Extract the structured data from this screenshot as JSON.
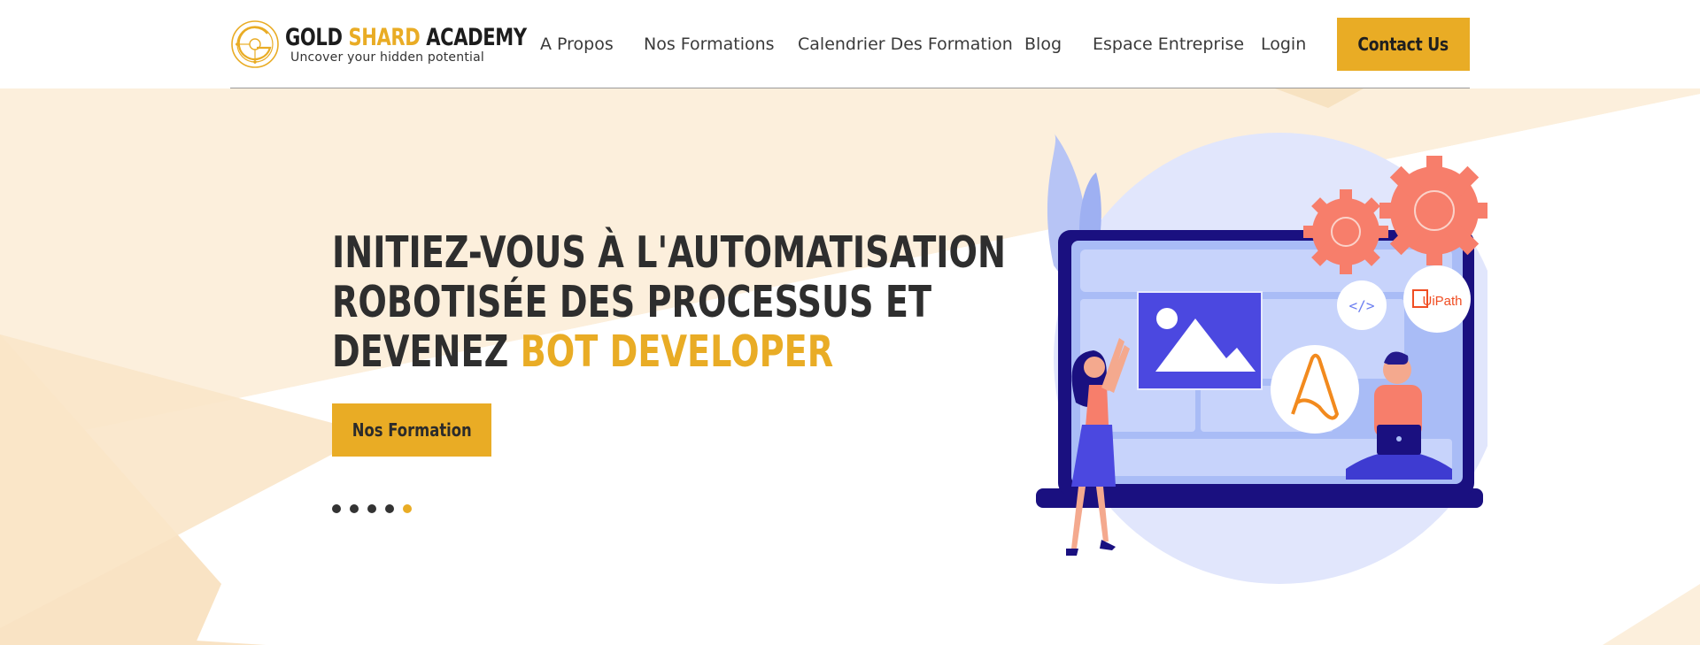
{
  "brand": {
    "name_part1": "GOLD",
    "name_part2": "SHARD",
    "name_part3": "ACADEMY",
    "tagline": "Uncover  your hidden potential",
    "accent_color": "#e9ac25"
  },
  "nav": {
    "items": [
      {
        "label": "A Propos"
      },
      {
        "label": "Nos Formations"
      },
      {
        "label": "Calendrier Des Formation"
      },
      {
        "label": "Blog"
      },
      {
        "label": "Espace Entreprise"
      },
      {
        "label": "Login"
      }
    ],
    "contact_label": "Contact Us"
  },
  "hero": {
    "headline_line1": "INITIEZ-VOUS À L'AUTOMATISATION",
    "headline_line2": "ROBOTISÉE DES PROCESSUS ET",
    "headline_line3_prefix": "DEVENEZ",
    "headline_line3_highlight": "BOT DEVELOPER",
    "cta_label": "Nos Formation",
    "slides_total": 5,
    "slide_active": 5
  },
  "illustration": {
    "uipath_badge": "UiPath",
    "code_badge": "</>",
    "icons": [
      "gear-icon",
      "image-icon",
      "automation-anywhere-logo",
      "uipath-logo",
      "code-icon"
    ]
  }
}
